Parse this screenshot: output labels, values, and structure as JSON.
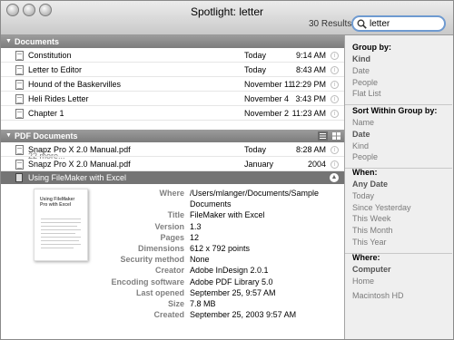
{
  "window": {
    "title": "Spotlight: letter",
    "results": "30 Results"
  },
  "search": {
    "value": "letter"
  },
  "documents": {
    "header": "Documents",
    "rows": [
      {
        "name": "Constitution",
        "date": "Today",
        "time": "9:14 AM"
      },
      {
        "name": "Letter to Editor",
        "date": "Today",
        "time": "8:43 AM"
      },
      {
        "name": "Hound of the Baskervilles",
        "date": "November 11",
        "time": "12:29 PM"
      },
      {
        "name": "Heli Rides Letter",
        "date": "November 4",
        "time": "3:43 PM"
      },
      {
        "name": "Chapter 1",
        "date": "November 2",
        "time": "11:23 AM"
      }
    ],
    "more": "22 more..."
  },
  "pdf": {
    "header": "PDF Documents",
    "rows": [
      {
        "name": "Snapz Pro X 2.0 Manual.pdf",
        "date": "Today",
        "time": "8:28 AM"
      },
      {
        "name": "Snapz Pro X 2.0 Manual.pdf",
        "date": "January",
        "time": "2004"
      }
    ],
    "selected": "Using FileMaker with Excel"
  },
  "details": {
    "thumbnail_text": "Using FileMaker Pro with Excel",
    "fields": [
      {
        "key": "Where",
        "value": "/Users/mlanger/Documents/Sample"
      },
      {
        "key": "",
        "value": "Documents"
      },
      {
        "key": "Title",
        "value": "FileMaker with Excel"
      },
      {
        "key": "Version",
        "value": "1.3"
      },
      {
        "key": "Pages",
        "value": "12"
      },
      {
        "key": "Dimensions",
        "value": "612 x 792 points"
      },
      {
        "key": "Security method",
        "value": "None"
      },
      {
        "key": "Creator",
        "value": "Adobe InDesign 2.0.1"
      },
      {
        "key": "Encoding software",
        "value": "Adobe PDF Library 5.0"
      },
      {
        "key": "Last opened",
        "value": "September 25, 9:57 AM"
      },
      {
        "key": "Size",
        "value": "7.8 MB"
      },
      {
        "key": "Created",
        "value": "September 25, 2003 9:57 AM"
      }
    ]
  },
  "sidebar": {
    "group_by": {
      "heading": "Group by:",
      "items": [
        "Kind",
        "Date",
        "People",
        "Flat List"
      ],
      "selected": "Kind"
    },
    "sort_by": {
      "heading": "Sort Within Group by:",
      "items": [
        "Name",
        "Date",
        "Kind",
        "People"
      ],
      "selected": "Date"
    },
    "when": {
      "heading": "When:",
      "items": [
        "Any Date",
        "Today",
        "Since Yesterday",
        "This Week",
        "This Month",
        "This Year"
      ],
      "selected": "Any Date"
    },
    "where": {
      "heading": "Where:",
      "items": [
        "Computer",
        "Home"
      ],
      "selected": "Computer",
      "extra": "Macintosh HD"
    }
  }
}
